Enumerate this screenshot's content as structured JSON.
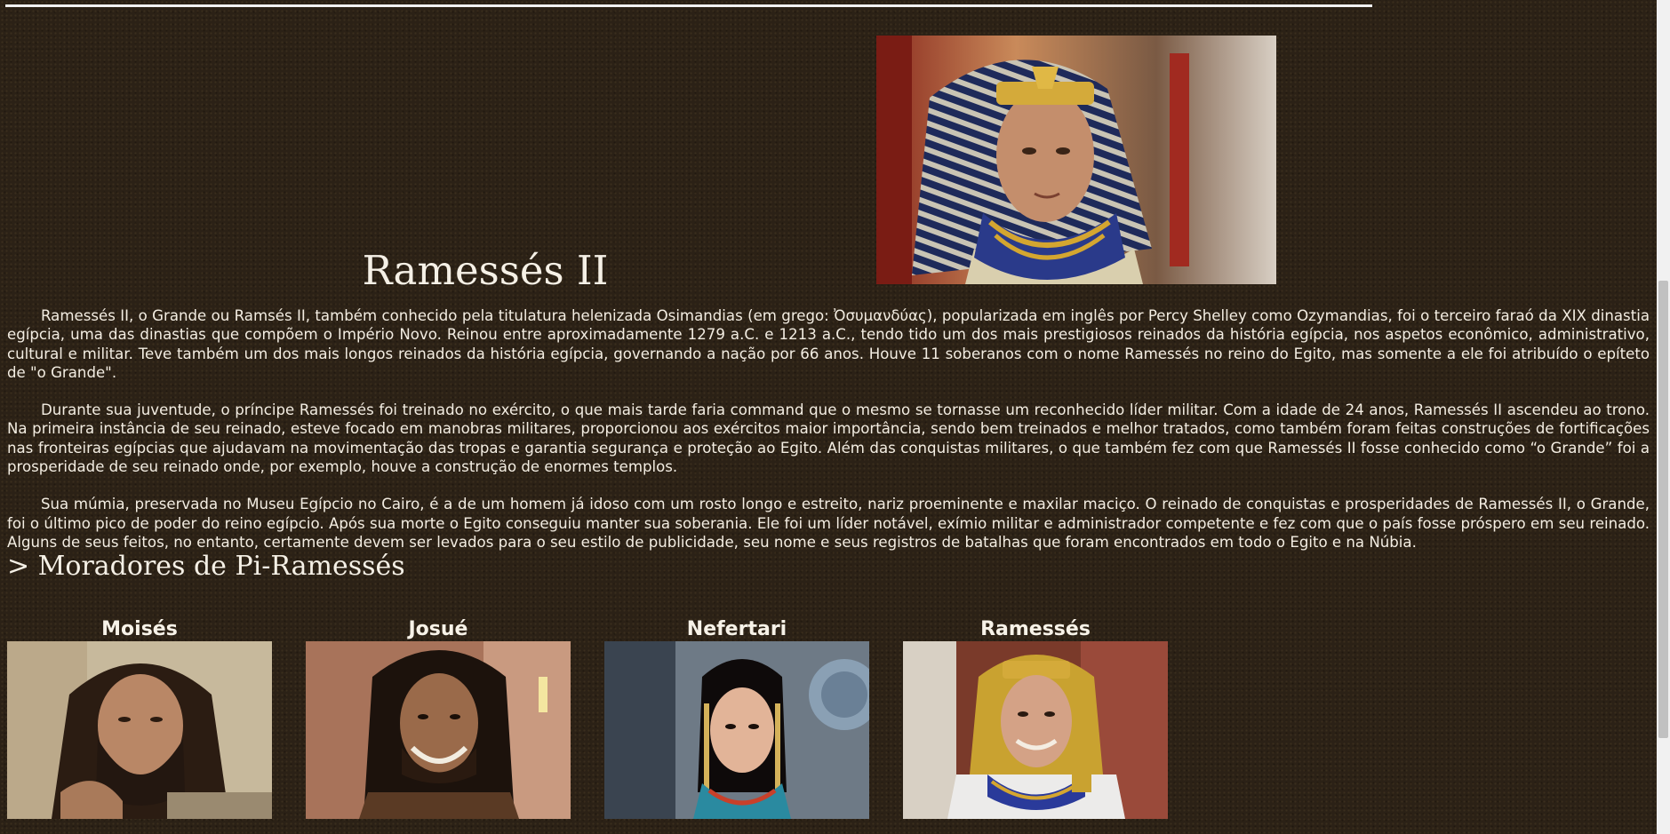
{
  "page": {
    "title": "Ramessés II",
    "paragraphs": [
      "Ramessés II, o Grande ou Ramsés II, também conhecido pela titulatura helenizada Osimandias (em grego: Ὀσυμανδύας), popularizada em inglês por Percy Shelley como Ozymandias, foi o terceiro faraó da XIX dinastia egípcia, uma das dinastias que compõem o Império Novo. Reinou entre aproximadamente 1279 a.C. e 1213 a.C., tendo tido um dos mais prestigiosos reinados da história egípcia, nos aspetos econômico, administrativo, cultural e militar. Teve também um dos mais longos reinados da história egípcia, governando a nação por 66 anos. Houve 11 soberanos com o nome Ramessés no reino do Egito, mas somente a ele foi atribuído o epíteto de \"o Grande\".",
      "Durante sua juventude, o príncipe Ramessés foi treinado no exército, o que mais tarde faria command que o mesmo se tornasse um reconhecido líder militar. Com a idade de 24 anos, Ramessés II ascendeu ao trono. Na primeira instância de seu reinado, esteve focado em manobras militares, proporcionou aos exércitos maior importância, sendo bem treinados e melhor tratados, como também foram feitas construções de fortificações nas fronteiras egípcias que ajudavam na movimentação das tropas e garantia segurança e proteção ao Egito. Além das conquistas militares, o que também fez com que Ramessés II fosse conhecido como “o Grande” foi a prosperidade de seu reinado onde, por exemplo, houve a construção de enormes templos.",
      "Sua múmia, preservada no Museu Egípcio no Cairo, é a de um homem já idoso com um rosto longo e estreito, nariz proeminente e maxilar maciço. O reinado de conquistas e prosperidades de Ramessés II, o Grande, foi o último pico de poder do reino egípcio. Após sua morte o Egito conseguiu manter sua soberania. Ele foi um líder notável, exímio militar e administrador competente e fez com que o país fosse próspero em seu reinado. Alguns de seus feitos, no entanto, certamente devem ser levados para o seu estilo de publicidade, seu nome e seus registros de batalhas que foram encontrados em todo o Egito e na Núbia."
    ],
    "section_heading": "> Moradores de Pi-Ramessés",
    "residents": [
      {
        "name": "Moisés"
      },
      {
        "name": "Josué"
      },
      {
        "name": "Nefertari"
      },
      {
        "name": "Ramessés"
      }
    ]
  },
  "colors": {
    "background": "#2b2116",
    "text": "#f3ede2",
    "rule": "#f2f2f2"
  }
}
